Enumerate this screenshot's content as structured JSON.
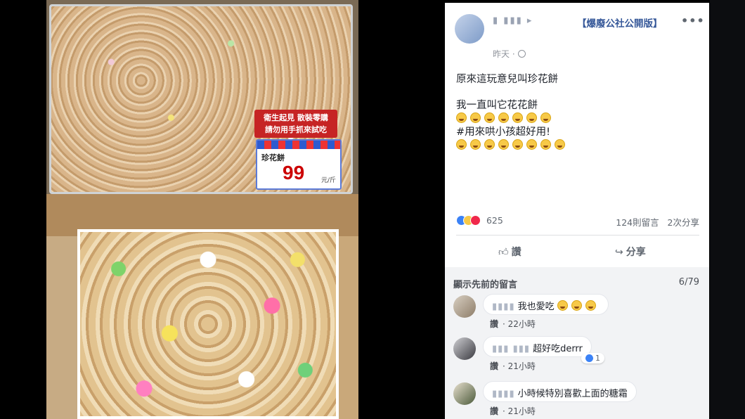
{
  "photo": {
    "warning_line1": "衛生起見 散裝零購",
    "warning_line2": "請勿用手抓來試吃",
    "price_name": "珍花餅",
    "price_value": "99",
    "price_unit": "元/斤"
  },
  "post": {
    "group_name": "【爆廢公社公開版】",
    "more_label": "•••",
    "time_label": "昨天 ·",
    "line1": "原來這玩意兒叫珍花餅",
    "line2": "我一直叫它花花餅",
    "line3": "#用來哄小孩超好用!",
    "reaction_count": "625",
    "comments_count": "124則留言",
    "shares_count": "2次分享",
    "like_label": "讚",
    "share_label": "分享"
  },
  "comments": {
    "show_previous": "顯示先前的留言",
    "page_count": "6/79",
    "items": [
      {
        "text": "我也愛吃",
        "like": "讚",
        "time": "22小時"
      },
      {
        "text": "超好吃derrr",
        "like": "讚",
        "time": "21小時",
        "reactions": "1"
      },
      {
        "text": "小時候特別喜歡上面的糖霜",
        "like": "讚",
        "time": "21小時"
      }
    ]
  },
  "colors": {
    "link": "#365899",
    "facebook_blue": "#3b82f6",
    "price_red": "#c00000"
  }
}
